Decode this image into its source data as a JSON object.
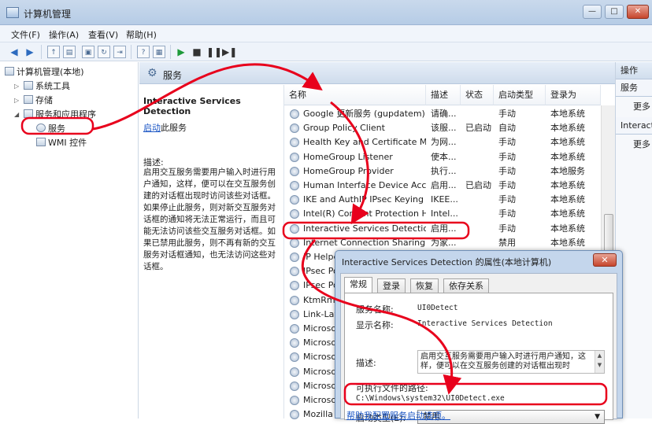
{
  "window": {
    "title": "计算机管理",
    "minimize": "—",
    "maximize": "□",
    "close": "✕"
  },
  "menu": [
    "文件(F)",
    "操作(A)",
    "查看(V)",
    "帮助(H)"
  ],
  "tree": {
    "root": "计算机管理(本地)",
    "system_tools": "系统工具",
    "storage": "存储",
    "services_apps": "服务和应用程序",
    "services": "服务",
    "wmi": "WMI 控件"
  },
  "services_header": {
    "title": "服务"
  },
  "detail": {
    "service_name": "Interactive Services Detection",
    "start_link": "启动",
    "start_suffix": "此服务",
    "description_label": "描述:",
    "description": "启用交互服务需要用户输入时进行用户通知，这样，便可以在交互服务创建的对话框出现时访问该些对话框。如果停止此服务，则对新交互服务对话框的通知将无法正常运行，而且可能无法访问该些交互服务对话框。如果已禁用此服务，则不再有新的交互服务对话框通知，也无法访问这些对话框。"
  },
  "list": {
    "columns": [
      "名称",
      "描述",
      "状态",
      "启动类型",
      "登录为"
    ],
    "rows": [
      {
        "name": "Google 更新服务 (gupdatem)",
        "desc": "请确...",
        "status": "",
        "startup": "手动",
        "logon": "本地系统"
      },
      {
        "name": "Group Policy Client",
        "desc": "该服...",
        "status": "已启动",
        "startup": "自动",
        "logon": "本地系统"
      },
      {
        "name": "Health Key and Certificate M...",
        "desc": "为网...",
        "status": "",
        "startup": "手动",
        "logon": "本地系统"
      },
      {
        "name": "HomeGroup Listener",
        "desc": "使本...",
        "status": "",
        "startup": "手动",
        "logon": "本地系统"
      },
      {
        "name": "HomeGroup Provider",
        "desc": "执行...",
        "status": "",
        "startup": "手动",
        "logon": "本地服务"
      },
      {
        "name": "Human Interface Device Access",
        "desc": "启用...",
        "status": "已启动",
        "startup": "手动",
        "logon": "本地系统"
      },
      {
        "name": "IKE and AuthIP IPsec Keying ...",
        "desc": "IKEE...",
        "status": "",
        "startup": "手动",
        "logon": "本地系统"
      },
      {
        "name": "Intel(R) Content Protection H...",
        "desc": "Intel...",
        "status": "",
        "startup": "手动",
        "logon": "本地系统"
      },
      {
        "name": "Interactive Services Detection",
        "desc": "启用...",
        "status": "",
        "startup": "手动",
        "logon": "本地系统"
      },
      {
        "name": "Internet Connection Sharing (...",
        "desc": "为家...",
        "status": "",
        "startup": "禁用",
        "logon": "本地系统"
      },
      {
        "name": "IP Helper",
        "desc": "",
        "status": "",
        "startup": "",
        "logon": ""
      },
      {
        "name": "IPsec Policy Agent",
        "desc": "",
        "status": "",
        "startup": "",
        "logon": ""
      },
      {
        "name": "IPsec Policy Agent",
        "desc": "",
        "status": "",
        "startup": "",
        "logon": ""
      },
      {
        "name": "KtmRm",
        "desc": "",
        "status": "",
        "startup": "",
        "logon": ""
      },
      {
        "name": "Link-Layer",
        "desc": "",
        "status": "",
        "startup": "",
        "logon": ""
      },
      {
        "name": "Microsoft",
        "desc": "",
        "status": "",
        "startup": "",
        "logon": ""
      },
      {
        "name": "Microsoft",
        "desc": "",
        "status": "",
        "startup": "",
        "logon": ""
      },
      {
        "name": "Microsoft",
        "desc": "",
        "status": "",
        "startup": "",
        "logon": ""
      },
      {
        "name": "Microsoft",
        "desc": "",
        "status": "",
        "startup": "",
        "logon": ""
      },
      {
        "name": "Microsoft",
        "desc": "",
        "status": "",
        "startup": "",
        "logon": ""
      },
      {
        "name": "Microsoft",
        "desc": "",
        "status": "",
        "startup": "",
        "logon": ""
      },
      {
        "name": "Mozilla",
        "desc": "",
        "status": "",
        "startup": "",
        "logon": ""
      }
    ]
  },
  "actions": {
    "header": "操作",
    "section1": "服务",
    "more1": "更多",
    "section2": "Interactive",
    "more2": "更多"
  },
  "dialog": {
    "title": "Interactive Services Detection 的属性(本地计算机)",
    "close": "✕",
    "tabs": [
      "常规",
      "登录",
      "恢复",
      "依存关系"
    ],
    "service_name_label": "服务名称:",
    "service_name_value": "UI0Detect",
    "display_name_label": "显示名称:",
    "display_name_value": "Interactive Services Detection",
    "description_label": "描述:",
    "description_value": "启用交互服务需要用户输入时进行用户通知，这样，便可以在交互服务创建的对话框出现时",
    "exe_path_label": "可执行文件的路径:",
    "exe_path_value": "C:\\Windows\\system32\\UI0Detect.exe",
    "startup_type_label": "启动类型(E):",
    "startup_type_value": "禁用",
    "help_link": "帮助我配置服务启动选项。"
  },
  "colors": {
    "annotation": "#e8001c",
    "link": "#1a55c4"
  }
}
